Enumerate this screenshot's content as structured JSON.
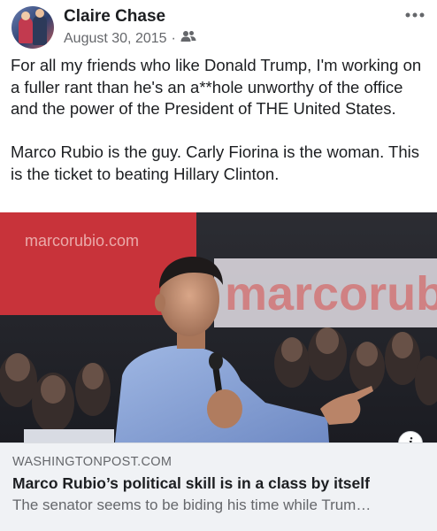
{
  "post": {
    "author": "Claire Chase",
    "date": "August 30, 2015",
    "separator": "·",
    "audience_icon": "friends-icon",
    "paragraphs": [
      "For all my friends who like Donald Trump, I'm working on a fuller rant than he's an a**hole unworthy of the office and the power of the President of THE United States.",
      "Marco Rubio is the guy. Carly Fiorina is the woman. This is the ticket to beating Hillary Clinton."
    ]
  },
  "link": {
    "image_sign_small": "marcorubio.com",
    "image_sign_large": "marcorubio",
    "domain": "WASHINGTONPOST.COM",
    "headline": "Marco Rubio’s political skill is in a class by itself",
    "description": "The senator seems to be biding his time while Trum…",
    "info_glyph": "i"
  },
  "colors": {
    "text": "#1c1e21",
    "secondary": "#65676b",
    "card_bg": "#f0f2f5",
    "sign_red": "#c8333a"
  }
}
